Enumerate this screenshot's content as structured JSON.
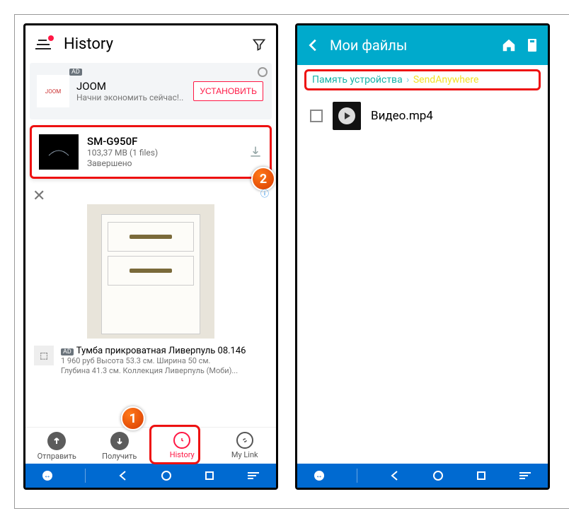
{
  "left": {
    "header_title": "History",
    "ad1_tag": "AD",
    "ad1_title": "JOOM",
    "ad1_sub": "Начни экономить сейчас!..",
    "ad1_btn": "УСТАНОВИТЬ",
    "transfer": {
      "name": "SM-G950F",
      "meta": "103,37 MB (1 files)",
      "status": "Завершено"
    },
    "ad2_tag": "AD",
    "ad2_title": "Тумба прикроватная Ливерпуль 08.146",
    "ad2_line1": "1 960 руб Высота 53.3 см. Ширина 50 см.",
    "ad2_line2": "Глубина 41.3 см. Коллекция Ливерпуль (Моби)...",
    "nav": {
      "send": "Отправить",
      "recv": "Получить",
      "hist": "History",
      "link": "My Link"
    },
    "anno1": "1",
    "anno2": "2"
  },
  "right": {
    "title": "Мои файлы",
    "crumb1": "Память устройства",
    "crumb2": "SendAnywhere",
    "file": "Видео.mp4"
  }
}
